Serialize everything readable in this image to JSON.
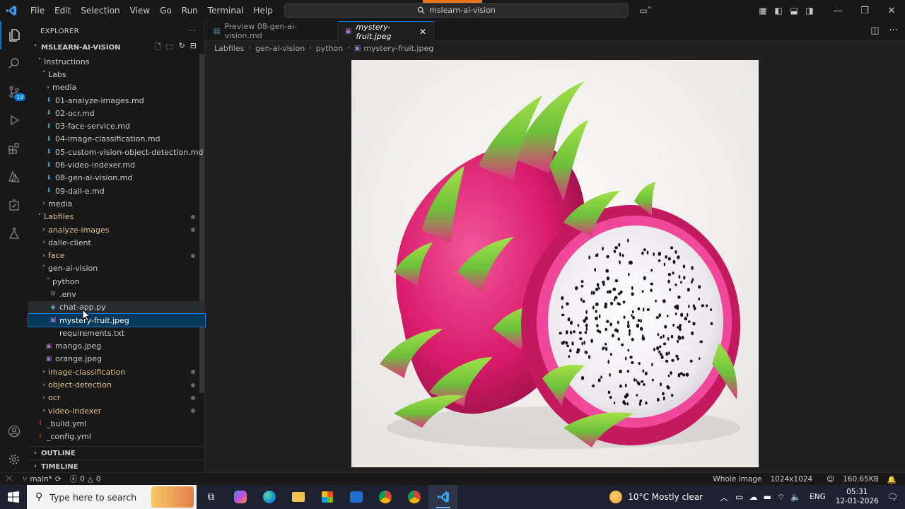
{
  "titlebar": {
    "menu": [
      "File",
      "Edit",
      "Selection",
      "View",
      "Go",
      "Run",
      "Terminal",
      "Help"
    ],
    "search_text": "mslearn-ai-vision"
  },
  "activity": {
    "scm_badge": "19"
  },
  "explorer": {
    "title": "EXPLORER",
    "more": "···",
    "root": "MSLEARN-AI-VISION",
    "items": [
      {
        "label": "Instructions",
        "icon": "folder-open"
      },
      {
        "label": "Labs",
        "icon": "folder-open"
      },
      {
        "label": "media",
        "icon": "folder-closed"
      },
      {
        "label": "01-analyze-images.md",
        "icon": "markdown-icon"
      },
      {
        "label": "02-ocr.md",
        "icon": "markdown-icon"
      },
      {
        "label": "03-face-service.md",
        "icon": "markdown-icon"
      },
      {
        "label": "04-image-classification.md",
        "icon": "markdown-icon"
      },
      {
        "label": "05-custom-vision-object-detection.md",
        "icon": "markdown-icon"
      },
      {
        "label": "06-video-indexer.md",
        "icon": "markdown-icon"
      },
      {
        "label": "08-gen-ai-vision.md",
        "icon": "markdown-icon"
      },
      {
        "label": "09-dall-e.md",
        "icon": "markdown-icon"
      },
      {
        "label": "media",
        "icon": "folder-closed"
      },
      {
        "label": "Labfiles",
        "icon": "folder-open"
      },
      {
        "label": "analyze-images",
        "icon": "folder-closed"
      },
      {
        "label": "dalle-client",
        "icon": "folder-closed"
      },
      {
        "label": "face",
        "icon": "folder-closed"
      },
      {
        "label": "gen-ai-vision",
        "icon": "folder-open"
      },
      {
        "label": "python",
        "icon": "folder-open"
      },
      {
        "label": ".env",
        "icon": "gear-icon"
      },
      {
        "label": "chat-app.py",
        "icon": "python-icon"
      },
      {
        "label": "mystery-fruit.jpeg",
        "icon": "image-icon"
      },
      {
        "label": "requirements.txt",
        "icon": "text-icon"
      },
      {
        "label": "mango.jpeg",
        "icon": "image-icon"
      },
      {
        "label": "orange.jpeg",
        "icon": "image-icon"
      },
      {
        "label": "image-classification",
        "icon": "folder-closed"
      },
      {
        "label": "object-detection",
        "icon": "folder-closed"
      },
      {
        "label": "ocr",
        "icon": "folder-closed"
      },
      {
        "label": "video-indexer",
        "icon": "folder-closed"
      },
      {
        "label": "_build.yml",
        "icon": "yaml-icon"
      },
      {
        "label": "_config.yml",
        "icon": "yaml-icon"
      }
    ],
    "outline": "OUTLINE",
    "timeline": "TIMELINE"
  },
  "tabs": [
    {
      "label": "Preview 08-gen-ai-vision.md",
      "active": false
    },
    {
      "label": "mystery-fruit.jpeg",
      "active": true
    }
  ],
  "breadcrumb": [
    "Labfiles",
    "gen-ai-vision",
    "python",
    "mystery-fruit.jpeg"
  ],
  "status": {
    "branch": "main*",
    "errors": "0",
    "warnings": "0",
    "view_mode": "Whole Image",
    "dimensions": "1024x1024",
    "file_size": "160.65KB"
  },
  "taskbar": {
    "search_placeholder": "Here to search",
    "search_label": "Type here to search",
    "weather": "10°C  Mostly clear",
    "language": "ENG",
    "time": "05:31",
    "date": "12-01-2026"
  }
}
